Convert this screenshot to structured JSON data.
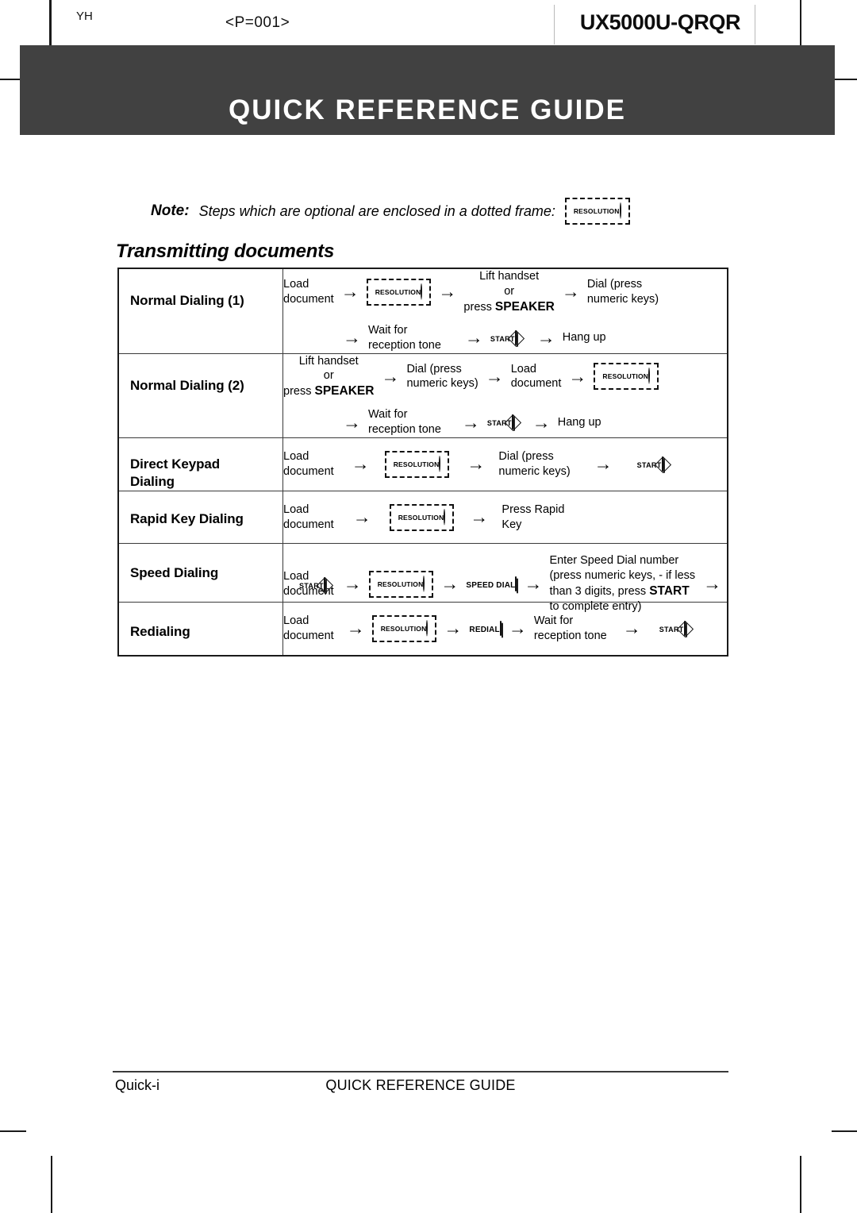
{
  "meta": {
    "corner_mark": "ΥΗ",
    "page_code": "<P=001>",
    "model_code": "UX5000U-QRQR"
  },
  "banner": {
    "title": "QUICK REFERENCE GUIDE"
  },
  "note": {
    "label": "Note:",
    "text": "Steps which are optional are enclosed in a dotted frame:",
    "sample_button": "RESOLUTION"
  },
  "section": {
    "heading": "Transmitting documents"
  },
  "buttons": {
    "resolution": "RESOLUTION",
    "start": "START",
    "speed_dial": "SPEED DIAL",
    "redial": "REDIAL"
  },
  "table": {
    "rows": [
      {
        "label": "Normal Dialing (1)",
        "steps_line1": {
          "s1": "Load\ndocument",
          "s3": "Lift handset\nor\npress SPEAKER",
          "s5": "Dial (press\nnumeric keys)"
        },
        "steps_line2": {
          "s2": "Wait for\nreception tone",
          "s6": "Hang up"
        }
      },
      {
        "label": "Normal Dialing (2)",
        "steps_line1": {
          "s1": "Lift handset\nor\npress SPEAKER",
          "s3": "Dial (press\nnumeric keys)",
          "s5": "Load\ndocument"
        },
        "steps_line2": {
          "s2": "Wait for\nreception tone",
          "s6": "Hang up"
        }
      },
      {
        "label": "Direct Keypad\nDialing",
        "steps_line1": {
          "s1": "Load\ndocument",
          "s5": "Dial (press\nnumeric keys)"
        }
      },
      {
        "label": "Rapid Key Dialing",
        "steps_line1": {
          "s1": "Load\ndocument",
          "s5": "Press Rapid\nKey"
        }
      },
      {
        "label": "Speed Dialing",
        "steps_line1": {
          "s1": "Load\ndocument",
          "s7": "Enter Speed Dial number\n(press numeric keys, - if less\nthan 3 digits, press START\nto complete entry)"
        }
      },
      {
        "label": "Redialing",
        "steps_line1": {
          "s1": "Load\ndocument",
          "s7": "Wait for\nreception tone"
        }
      }
    ]
  },
  "labels": {
    "load_document_l1": "Load",
    "load_document_l2": "document",
    "lift_handset": "Lift handset",
    "or": "or",
    "press": "press ",
    "speaker": "SPEAKER",
    "dial_l1": "Dial (press",
    "dial_l2": "numeric keys)",
    "wait_l1": "Wait for",
    "wait_l2": "reception tone",
    "hang_up": "Hang up",
    "press_rapid_l1": "Press Rapid",
    "press_rapid_l2": "Key",
    "sd_l1": "Enter Speed Dial number",
    "sd_l2": "(press numeric keys, - if less",
    "sd_l3a": "than 3 digits, press ",
    "sd_l3b": "START",
    "sd_l4": "to complete entry)",
    "arrow": "→"
  },
  "footer": {
    "page": "Quick-i",
    "title": "QUICK REFERENCE GUIDE"
  },
  "colors": {
    "banner_bg": "#414141",
    "banner_text": "#ffffff",
    "rule": "#3a3a3a",
    "key_face": "#d6d6d6"
  }
}
